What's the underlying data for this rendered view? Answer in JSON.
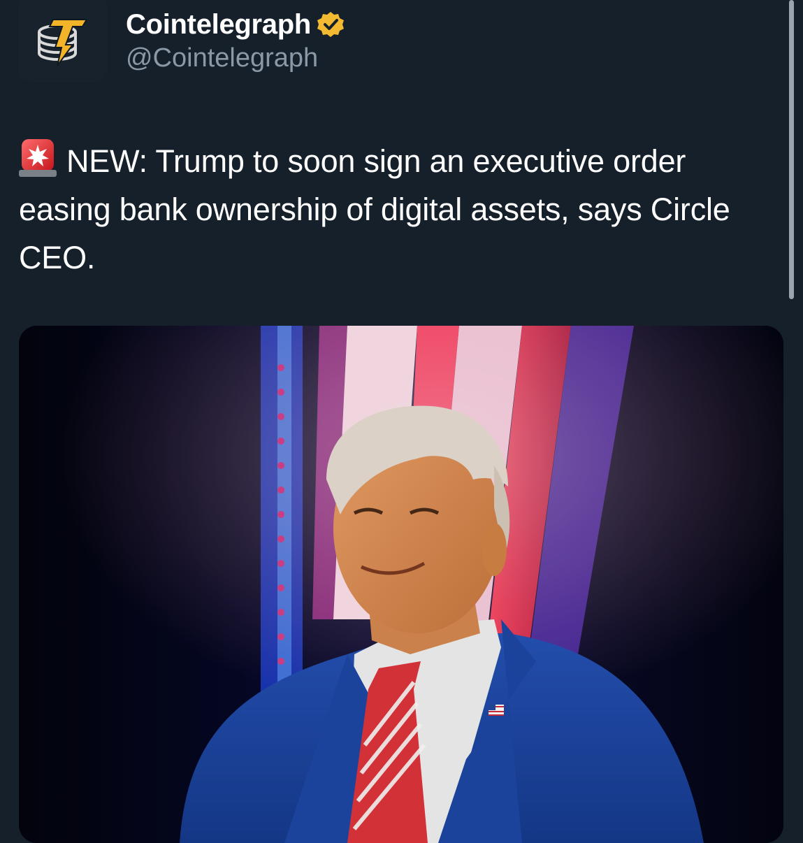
{
  "account": {
    "display_name": "Cointelegraph",
    "handle": "@Cointelegraph",
    "verified": true,
    "badge_color": "#f2b931",
    "avatar_icon": "cointelegraph-logo-icon"
  },
  "post": {
    "alert_icon": "police-car-light-icon",
    "text": "NEW: Trump to soon sign an executive order easing bank ownership of digital assets, says Circle CEO."
  },
  "media": {
    "type": "photo",
    "icon": "photo-of-man-in-blue-suit"
  },
  "colors": {
    "background": "#15202b",
    "text_primary": "#ffffff",
    "text_secondary": "#8b98a5",
    "logo_gold": "#f4b42a"
  }
}
